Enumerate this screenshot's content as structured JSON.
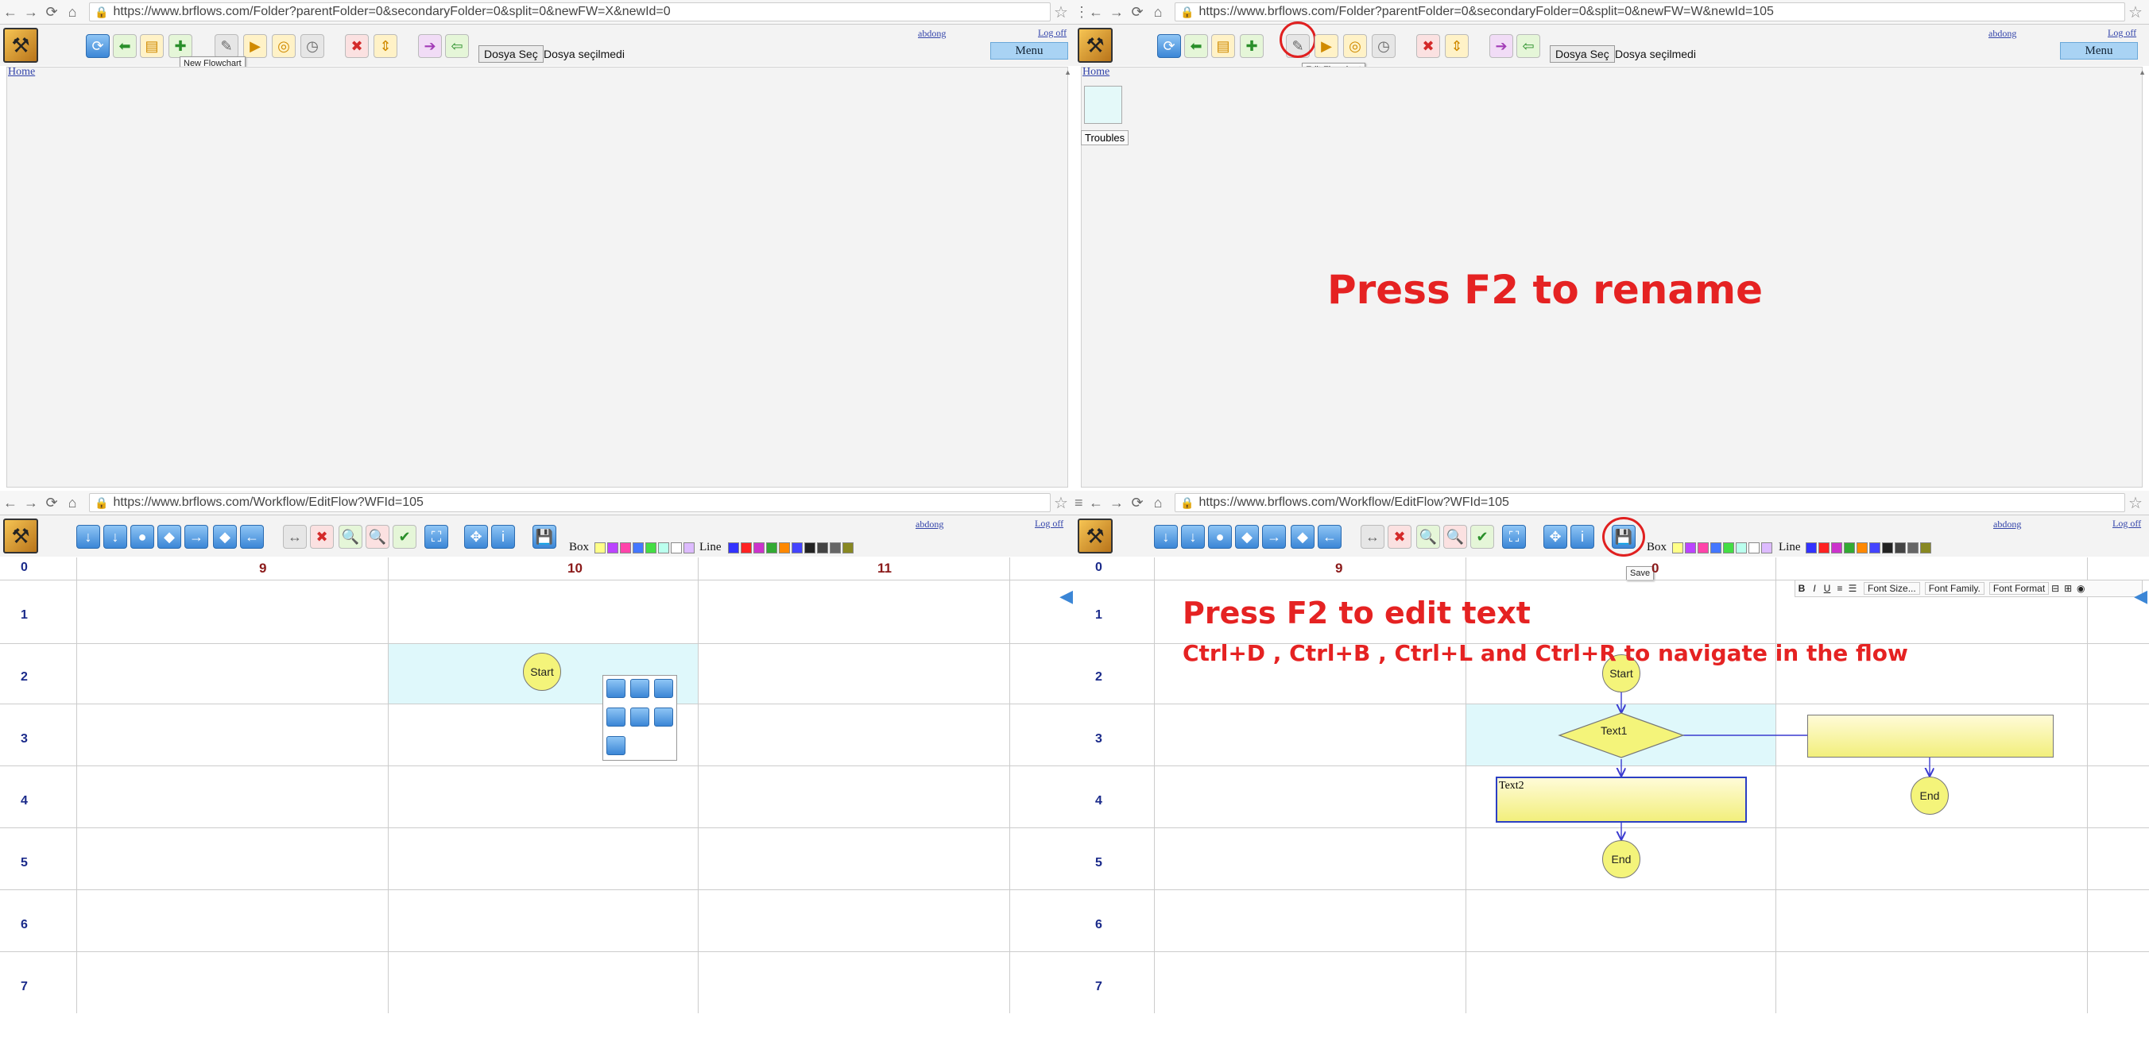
{
  "q1": {
    "url": "https://www.brflows.com/Folder?parentFolder=0&secondaryFolder=0&split=0&newFW=X&newId=0",
    "tooltip": "New Flowchart",
    "file_button": "Dosya Seç",
    "file_status": "Dosya seçilmedi",
    "user": "abdong",
    "logoff": "Log off",
    "menu": "Menu",
    "home": "Home"
  },
  "q2": {
    "url": "https://www.brflows.com/Folder?parentFolder=0&secondaryFolder=0&split=0&newFW=W&newId=105",
    "tooltip": "Edit Flowchart",
    "file_button": "Dosya Seç",
    "file_status": "Dosya seçilmedi",
    "user": "abdong",
    "logoff": "Log off",
    "menu": "Menu",
    "home": "Home",
    "folder": "Troubles",
    "annotation": "Press F2 to rename"
  },
  "q3": {
    "url": "https://www.brflows.com/Workflow/EditFlow?WFId=105",
    "box_label": "Box",
    "line_label": "Line",
    "user": "abdong",
    "logoff": "Log off",
    "cols": [
      "9",
      "10",
      "11"
    ],
    "rows": [
      "0",
      "1",
      "2",
      "3",
      "4",
      "5",
      "6",
      "7"
    ],
    "start": "Start"
  },
  "q4": {
    "url": "https://www.brflows.com/Workflow/EditFlow?WFId=105",
    "box_label": "Box",
    "line_label": "Line",
    "user": "abdong",
    "logoff": "Log off",
    "save_tooltip": "Save",
    "cols": [
      "9",
      "0"
    ],
    "rows": [
      "0",
      "1",
      "2",
      "3",
      "4",
      "5",
      "6",
      "7"
    ],
    "annotation1": "Press F2 to edit text",
    "annotation2": "Ctrl+D , Ctrl+B , Ctrl+L and Ctrl+R to navigate in the flow",
    "start": "Start",
    "decision": "Text1",
    "textbox": "Text2",
    "end1": "End",
    "end2": "End",
    "rt_font_size": "Font Size...",
    "rt_font_family": "Font Family.",
    "rt_font_format": "Font Format",
    "rt_bold": "B",
    "rt_italic": "I",
    "rt_underline": "U"
  },
  "colors": {
    "box_swatches": [
      "#ffff88",
      "#bb44ff",
      "#ff44aa",
      "#4477ff",
      "#44dd44",
      "#bbffee",
      "#ffffff",
      "#ddbbff"
    ],
    "line_swatches": [
      "#3333ff",
      "#ff2222",
      "#cc33cc",
      "#33aa33",
      "#ff8800",
      "#4444ff",
      "#222222",
      "#444444",
      "#666666",
      "#888822"
    ],
    "annotation": "#e52222",
    "highlight": "#dff8fb"
  }
}
